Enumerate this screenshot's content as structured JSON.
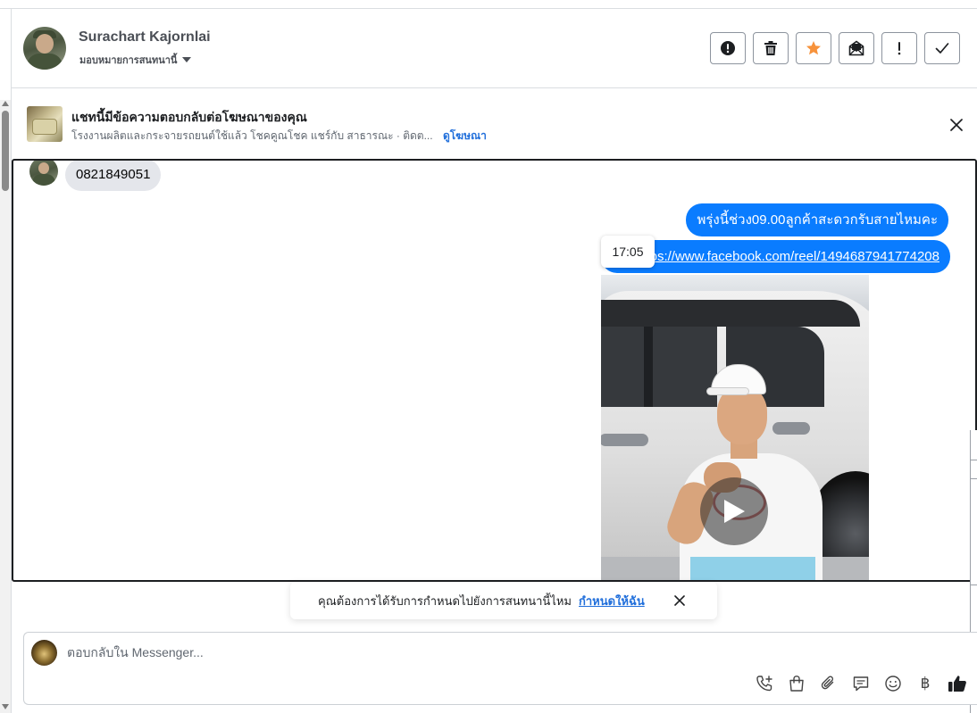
{
  "header": {
    "name": "Surachart Kajornlai",
    "assign_label": "มอบหมายการสนทนานี้",
    "actions": [
      {
        "name": "spam-button",
        "icon": "alert-circle-icon"
      },
      {
        "name": "delete-button",
        "icon": "trash-icon"
      },
      {
        "name": "star-button",
        "icon": "star-icon",
        "color": "#f7923b"
      },
      {
        "name": "mark-unread-button",
        "icon": "envelope-open-icon"
      },
      {
        "name": "follow-up-button",
        "icon": "exclamation-icon"
      },
      {
        "name": "done-button",
        "icon": "check-icon"
      }
    ]
  },
  "ad_banner": {
    "title": "แชทนี้มีข้อความตอบกลับต่อโฆษณาของคุณ",
    "subtitle": "โรงงานผลิตและกระจายรถยนต์ใช้แล้ว โชคคูณโชค แชร์กับ สาธารณะ · ติดต...",
    "link": "ดูโฆษณา"
  },
  "messages": {
    "received": "0821849051",
    "sent_1": "พรุ่งนี้ช่วง09.00ลูกค้าสะดวกรับสายไหมคะ",
    "sent_2": "https://www.facebook.com/reel/1494687941774208",
    "timestamp": "17:05"
  },
  "toast": {
    "text": "คุณต้องการได้รับการกำหนดไปยังการสนทนานี้ไหม",
    "link": "กำหนดให้ฉัน"
  },
  "composer": {
    "placeholder": "ตอบกลับใน Messenger...",
    "tools": [
      "call-add-icon",
      "shopping-bag-icon",
      "paperclip-icon",
      "saved-reply-icon",
      "emoji-icon",
      "baht-icon",
      "thumbs-up-icon"
    ],
    "baht_symbol": "฿"
  },
  "colors": {
    "accent": "#0a7cff",
    "link": "#216fdb",
    "star": "#f7923b"
  }
}
